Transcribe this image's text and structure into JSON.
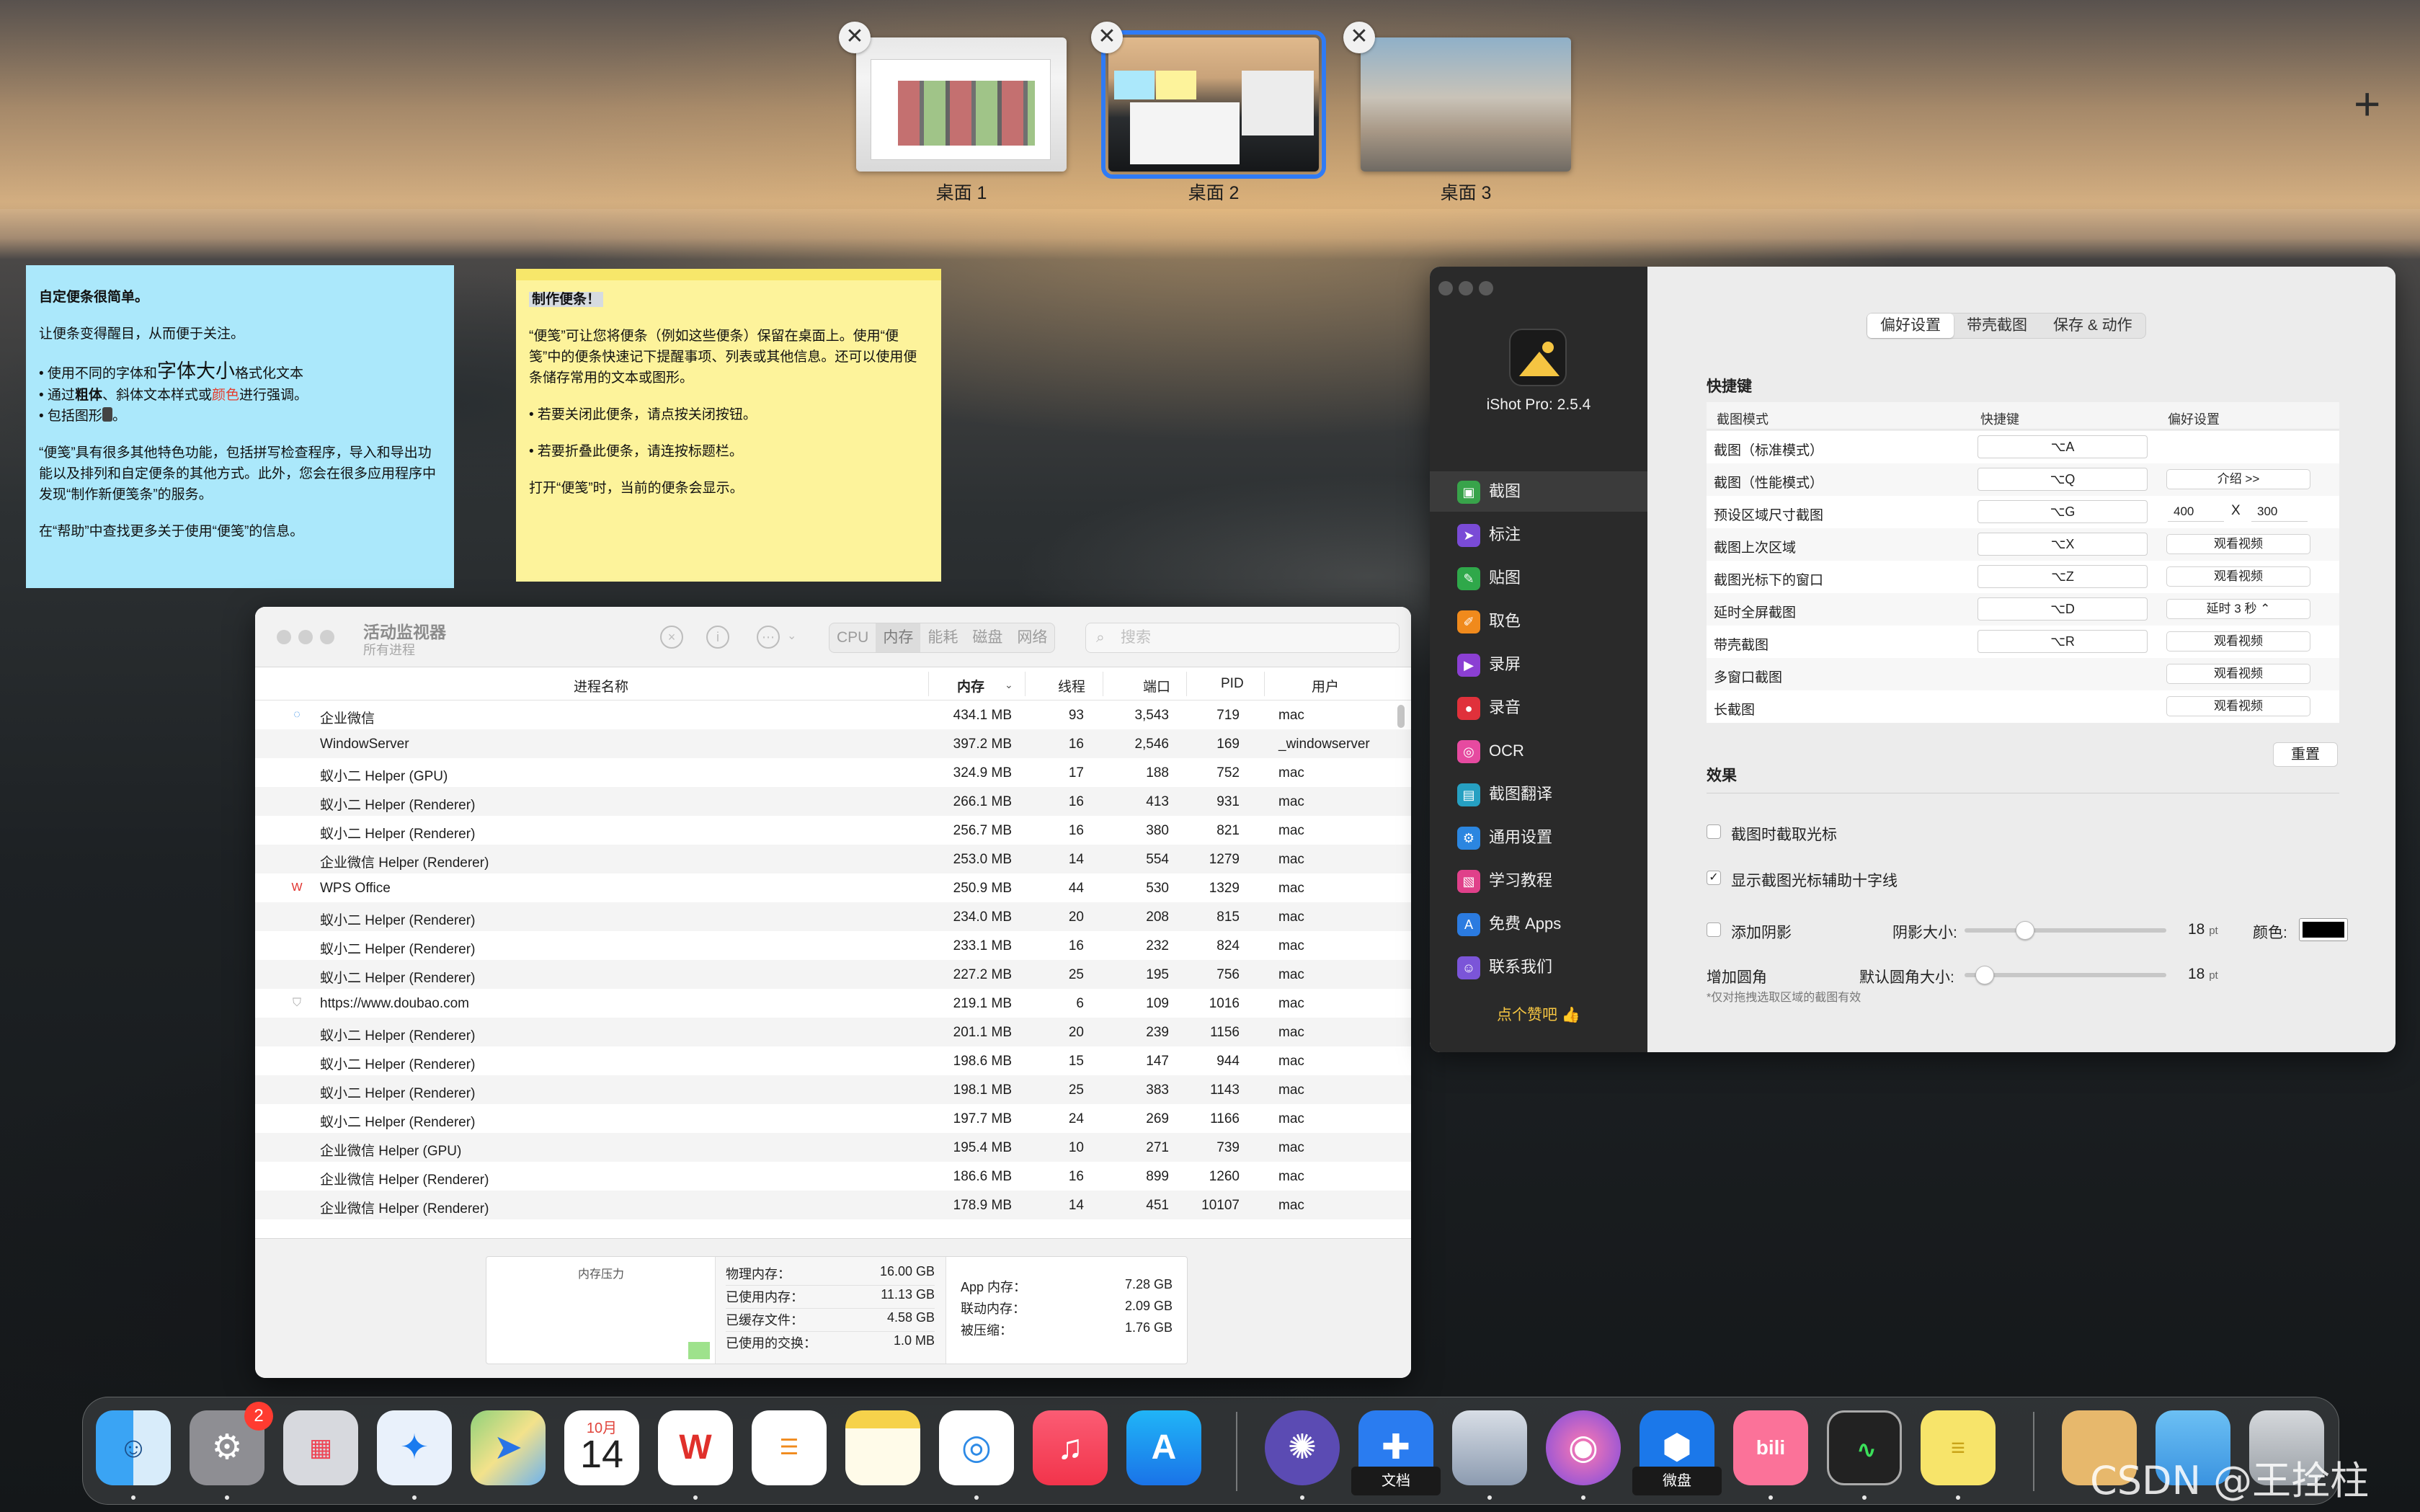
{
  "spaces": [
    {
      "label": "桌面 1",
      "active": false
    },
    {
      "label": "桌面 2",
      "active": true
    },
    {
      "label": "桌面 3",
      "active": false
    }
  ],
  "spaces_close_glyph": "✕",
  "spaces_add_glyph": "+",
  "sticky_blue": {
    "title": "自定便条很简单。",
    "intro": "让便条变得醒目，从而便于关注。",
    "bullet1_a": "• 使用不同的",
    "bullet1_b": "字体",
    "bullet1_c": "和",
    "bullet1_d": "字体大小",
    "bullet1_e": "格式化文本",
    "bullet2_a": "• 通过",
    "bullet2_b": "粗体",
    "bullet2_c": "、斜体文本样式或",
    "bullet2_d": "颜色",
    "bullet2_e": "进行强调。",
    "bullet3": "• 包括图形",
    "bullet3_end": "。",
    "para": "“便笺”具有很多其他特色功能，包括拼写检查程序，导入和导出功能以及排列和自定便条的其他方式。此外，您会在很多应用程序中发现“制作新便笺条”的服务。",
    "help": "在“帮助”中查找更多关于使用“便笺”的信息。"
  },
  "sticky_yellow": {
    "title": "制作便条！",
    "p1": "“便笺”可让您将便条（例如这些便条）保留在桌面上。使用“便笺”中的便条快速记下提醒事项、列表或其他信息。还可以使用便条储存常用的文本或图形。",
    "p2": "• 若要关闭此便条，请点按关闭按钮。",
    "p3": "• 若要折叠此便条，请连按标题栏。",
    "p4": "打开“便笺”时，当前的便条会显示。"
  },
  "activity_monitor": {
    "title": "活动监视器",
    "subtitle": "所有进程",
    "tabs": [
      "CPU",
      "内存",
      "能耗",
      "磁盘",
      "网络"
    ],
    "active_tab": "内存",
    "search_placeholder": "搜索",
    "columns": {
      "name": "进程名称",
      "mem": "内存",
      "threads": "线程",
      "ports": "端口",
      "pid": "PID",
      "user": "用户"
    },
    "rows": [
      {
        "icon": "wecom",
        "name": "企业微信",
        "mem": "434.1 MB",
        "threads": "93",
        "ports": "3,543",
        "pid": "719",
        "user": "mac"
      },
      {
        "icon": "",
        "name": "WindowServer",
        "mem": "397.2 MB",
        "threads": "16",
        "ports": "2,546",
        "pid": "169",
        "user": "_windowserver"
      },
      {
        "icon": "",
        "name": "蚁小二 Helper (GPU)",
        "mem": "324.9 MB",
        "threads": "17",
        "ports": "188",
        "pid": "752",
        "user": "mac"
      },
      {
        "icon": "",
        "name": "蚁小二 Helper (Renderer)",
        "mem": "266.1 MB",
        "threads": "16",
        "ports": "413",
        "pid": "931",
        "user": "mac"
      },
      {
        "icon": "",
        "name": "蚁小二 Helper (Renderer)",
        "mem": "256.7 MB",
        "threads": "16",
        "ports": "380",
        "pid": "821",
        "user": "mac"
      },
      {
        "icon": "",
        "name": "企业微信 Helper (Renderer)",
        "mem": "253.0 MB",
        "threads": "14",
        "ports": "554",
        "pid": "1279",
        "user": "mac"
      },
      {
        "icon": "wps",
        "name": "WPS Office",
        "mem": "250.9 MB",
        "threads": "44",
        "ports": "530",
        "pid": "1329",
        "user": "mac"
      },
      {
        "icon": "",
        "name": "蚁小二 Helper (Renderer)",
        "mem": "234.0 MB",
        "threads": "20",
        "ports": "208",
        "pid": "815",
        "user": "mac"
      },
      {
        "icon": "",
        "name": "蚁小二 Helper (Renderer)",
        "mem": "233.1 MB",
        "threads": "16",
        "ports": "232",
        "pid": "824",
        "user": "mac"
      },
      {
        "icon": "",
        "name": "蚁小二 Helper (Renderer)",
        "mem": "227.2 MB",
        "threads": "25",
        "ports": "195",
        "pid": "756",
        "user": "mac"
      },
      {
        "icon": "shield",
        "name": "https://www.doubao.com",
        "mem": "219.1 MB",
        "threads": "6",
        "ports": "109",
        "pid": "1016",
        "user": "mac"
      },
      {
        "icon": "",
        "name": "蚁小二 Helper (Renderer)",
        "mem": "201.1 MB",
        "threads": "20",
        "ports": "239",
        "pid": "1156",
        "user": "mac"
      },
      {
        "icon": "",
        "name": "蚁小二 Helper (Renderer)",
        "mem": "198.6 MB",
        "threads": "15",
        "ports": "147",
        "pid": "944",
        "user": "mac"
      },
      {
        "icon": "",
        "name": "蚁小二 Helper (Renderer)",
        "mem": "198.1 MB",
        "threads": "25",
        "ports": "383",
        "pid": "1143",
        "user": "mac"
      },
      {
        "icon": "",
        "name": "蚁小二 Helper (Renderer)",
        "mem": "197.7 MB",
        "threads": "24",
        "ports": "269",
        "pid": "1166",
        "user": "mac"
      },
      {
        "icon": "",
        "name": "企业微信 Helper (GPU)",
        "mem": "195.4 MB",
        "threads": "10",
        "ports": "271",
        "pid": "739",
        "user": "mac"
      },
      {
        "icon": "",
        "name": "企业微信 Helper (Renderer)",
        "mem": "186.6 MB",
        "threads": "16",
        "ports": "899",
        "pid": "1260",
        "user": "mac"
      },
      {
        "icon": "",
        "name": "企业微信 Helper (Renderer)",
        "mem": "178.9 MB",
        "threads": "14",
        "ports": "451",
        "pid": "10107",
        "user": "mac"
      }
    ],
    "pressure_title": "内存压力",
    "stats_mid": [
      {
        "k": "物理内存：",
        "v": "16.00 GB"
      },
      {
        "k": "已使用内存：",
        "v": "11.13 GB"
      },
      {
        "k": "已缓存文件：",
        "v": "4.58 GB"
      },
      {
        "k": "已使用的交换：",
        "v": "1.0 MB"
      }
    ],
    "stats_right": [
      {
        "k": "App 内存：",
        "v": "7.28 GB"
      },
      {
        "k": "联动内存：",
        "v": "2.09 GB"
      },
      {
        "k": "被压缩：",
        "v": "1.76 GB"
      }
    ]
  },
  "ishot": {
    "version": "iShot Pro: 2.5.4",
    "sidebar": [
      {
        "label": "截图",
        "icon": "▣",
        "color": "#38a34a"
      },
      {
        "label": "标注",
        "icon": "➤",
        "color": "#7a4bd6"
      },
      {
        "label": "贴图",
        "icon": "✎",
        "color": "#2fa84a"
      },
      {
        "label": "取色",
        "icon": "✐",
        "color": "#f08a1c"
      },
      {
        "label": "录屏",
        "icon": "▶",
        "color": "#8b3fd3"
      },
      {
        "label": "录音",
        "icon": "●",
        "color": "#e0313b"
      },
      {
        "label": "OCR",
        "icon": "◎",
        "color": "#e64aa0"
      },
      {
        "label": "截图翻译",
        "icon": "▤",
        "color": "#26a0c2"
      },
      {
        "label": "通用设置",
        "icon": "⚙",
        "color": "#2b86e0"
      },
      {
        "label": "学习教程",
        "icon": "▧",
        "color": "#e0408a"
      },
      {
        "label": "免费 Apps",
        "icon": "A",
        "color": "#2b7be0"
      },
      {
        "label": "联系我们",
        "icon": "☺",
        "color": "#7b55d8"
      }
    ],
    "selected_item": "截图",
    "like": "点个赞吧 👍",
    "tabs": [
      "偏好设置",
      "带壳截图",
      "保存 & 动作"
    ],
    "active_tab": "偏好设置",
    "shortcut_title": "快捷键",
    "table_head": {
      "mode": "截图模式",
      "key": "快捷键",
      "pref": "偏好设置"
    },
    "shortcuts": [
      {
        "mode": "截图（标准模式）",
        "key": "⌥A",
        "pref": ""
      },
      {
        "mode": "截图（性能模式）",
        "key": "⌥Q",
        "pref": "介绍 >>"
      },
      {
        "mode": "预设区域尺寸截图",
        "key": "⌥G",
        "pref": "size",
        "w": "400",
        "x": "X",
        "h": "300"
      },
      {
        "mode": "截图上次区域",
        "key": "⌥X",
        "pref": "观看视频"
      },
      {
        "mode": "截图光标下的窗口",
        "key": "⌥Z",
        "pref": "观看视频"
      },
      {
        "mode": "延时全屏截图",
        "key": "⌥D",
        "pref": "延时 3 秒 ⌃"
      },
      {
        "mode": "带壳截图",
        "key": "⌥R",
        "pref": "观看视频"
      },
      {
        "mode": "多窗口截图",
        "key": "",
        "pref": "观看视频"
      },
      {
        "mode": "长截图",
        "key": "",
        "pref": "观看视频"
      }
    ],
    "reset": "重置",
    "effects_title": "效果",
    "opt_cursor": "截图时截取光标",
    "opt_crosshair": "显示截图光标辅助十字线",
    "opt_shadow": "添加阴影",
    "shadow_size_label": "阴影大小:",
    "shadow_size_value": "18",
    "pt": "pt",
    "color_label": "颜色:",
    "shadow_color": "#000000",
    "shadow_level": 0.3,
    "corner_level": 0.1,
    "corner_title": "增加圆角",
    "corner_note": "*仅对拖拽选取区域的截图有效",
    "corner_size_label": "默认圆角大小:",
    "corner_size_value": "18",
    "checked_glyph": "✓"
  },
  "dock": {
    "settings_badge": "2",
    "calendar_month": "10月",
    "calendar_day": "14",
    "tooltip_docs": "文档",
    "tooltip_weipan": "微盘"
  },
  "watermark": "CSDN @王拴柱"
}
